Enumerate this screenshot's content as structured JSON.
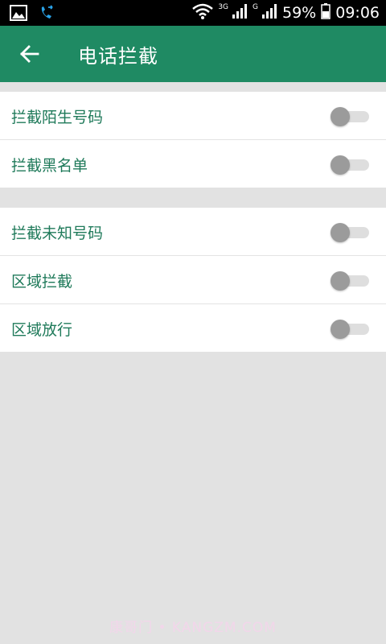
{
  "status_bar": {
    "network_label_1": "3G",
    "network_label_2": "G",
    "battery": "59%",
    "time": "09:06"
  },
  "app_bar": {
    "title": "电话拦截"
  },
  "group1": [
    {
      "label": "拦截陌生号码",
      "enabled": false
    },
    {
      "label": "拦截黑名单",
      "enabled": false
    }
  ],
  "group2": [
    {
      "label": "拦截未知号码",
      "enabled": false
    },
    {
      "label": "区域拦截",
      "enabled": false
    },
    {
      "label": "区域放行",
      "enabled": false
    }
  ],
  "watermark": "康哥门 • KANGZM.COM",
  "colors": {
    "primary": "#1f8a63",
    "label": "#1f7a5a",
    "background": "#e2e2e2"
  }
}
